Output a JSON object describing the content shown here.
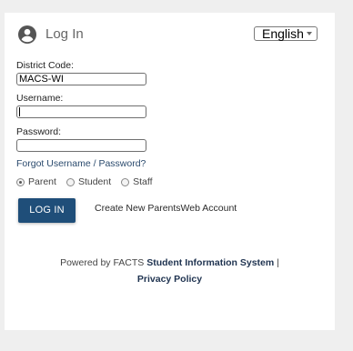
{
  "header": {
    "title": "Log In",
    "icon": "user-circle-icon"
  },
  "language": {
    "selected": "English"
  },
  "fields": {
    "district_code": {
      "label": "District Code:",
      "value": "MACS-WI"
    },
    "username": {
      "label": "Username:",
      "value": ""
    },
    "password": {
      "label": "Password:",
      "value": ""
    }
  },
  "forgot_link": "Forgot Username / Password?",
  "roles": {
    "options": [
      "Parent",
      "Student",
      "Staff"
    ],
    "selected": "Parent"
  },
  "login_button": "LOG IN",
  "create_account_link": "Create New ParentsWeb Account",
  "footer": {
    "powered_by": "Powered by FACTS",
    "sis_link": "Student Information System",
    "separator": "|",
    "privacy_link": "Privacy Policy"
  },
  "colors": {
    "primary_button": "#1f4e79",
    "link": "#2a4a6d",
    "page_background": "#efefef",
    "card_background": "#ffffff"
  }
}
